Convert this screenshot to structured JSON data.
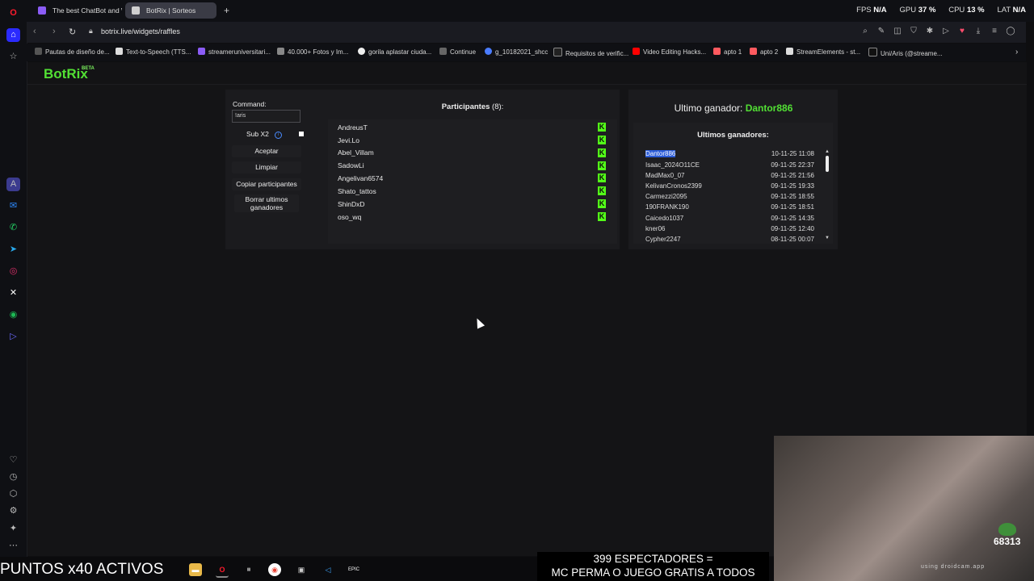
{
  "browser": {
    "tabs": [
      {
        "label": "The best ChatBot and Wid",
        "color": "#8b5cf6"
      },
      {
        "label": "BotRix | Sorteos",
        "color": "#4ade80"
      }
    ],
    "new_tab_icon": "plus-icon",
    "stats": {
      "fps_label": "FPS",
      "fps_value": "N/A",
      "gpu_label": "GPU",
      "gpu_value": "37 %",
      "cpu_label": "CPU",
      "cpu_value": "13 %",
      "lat_label": "LAT",
      "lat_value": "N/A"
    },
    "url": "botrix.live/widgets/raffles",
    "bookmarks": [
      "Pautas de diseño de...",
      "Text-to-Speech (TTS...",
      "streameruniversitari...",
      "40.000+ Fotos y Im...",
      "gorila aplastar ciuda...",
      "Continue",
      "g_10182021_shcc",
      "Requisitos de verific...",
      "Video Editing Hacks...",
      "apto 1",
      "apto 2",
      "StreamElements - st...",
      "Uni/Aris (@streame..."
    ]
  },
  "app": {
    "logo": "BotRix",
    "beta": "BETA"
  },
  "raffle": {
    "command_label": "Command:",
    "command_value": "!aris",
    "sub_label": "Sub X2",
    "buttons": {
      "accept": "Aceptar",
      "clear": "Limpiar",
      "copy": "Copiar participantes",
      "delete_winners": "Borrar ultimos ganadores"
    },
    "participants_title": "Participantes",
    "participants_count": "(8):",
    "participants": [
      "AndreusT",
      "Jevi.Lo",
      "Abel_Villam",
      "SadowLi",
      "Angelivan6574",
      "Shato_tattos",
      "ShinDxD",
      "oso_wq"
    ],
    "last_winner_label": "Ultimo ganador:",
    "last_winner_name": "Dantor886",
    "winners_title": "Ultimos ganadores:",
    "winners": [
      {
        "name": "Dantor886",
        "date": "10-11-25 11:08"
      },
      {
        "name": "Isaac_2024O11CE",
        "date": "09-11-25 22:37"
      },
      {
        "name": "MadMax0_07",
        "date": "09-11-25 21:56"
      },
      {
        "name": "KelivanCronos2399",
        "date": "09-11-25 19:33"
      },
      {
        "name": "Carmezzi2095",
        "date": "09-11-25 18:55"
      },
      {
        "name": "190FRANK190",
        "date": "09-11-25 18:51"
      },
      {
        "name": "Caicedo1037",
        "date": "09-11-25 14:35"
      },
      {
        "name": "kner06",
        "date": "09-11-25 12:40"
      },
      {
        "name": "Cypher2247",
        "date": "08-11-25 00:07"
      }
    ]
  },
  "stream": {
    "puntos": "PUNTOS x40 ACTIVOS",
    "espect_line1": "399 ESPECTADORES =",
    "espect_line2": "MC PERMA O JUEGO GRATIS A TODOS",
    "webcam_count": "68313",
    "webcam_tag": "using droidcam.app"
  }
}
